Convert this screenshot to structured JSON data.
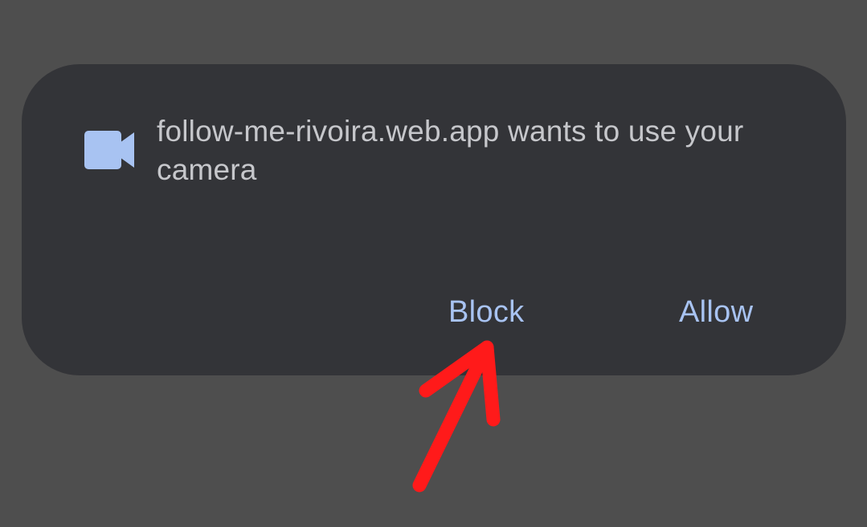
{
  "dialog": {
    "icon": "video-camera-icon",
    "message": "follow-me-rivoira.web.app wants to use your camera",
    "buttons": {
      "block_label": "Block",
      "allow_label": "Allow"
    }
  },
  "annotation": {
    "icon": "red-arrow-icon",
    "color": "#ff1a1a"
  },
  "colors": {
    "background": "#4e4e4e",
    "dialog": "#333438",
    "accent": "#a8c3f2",
    "text": "#c6c7cb"
  }
}
